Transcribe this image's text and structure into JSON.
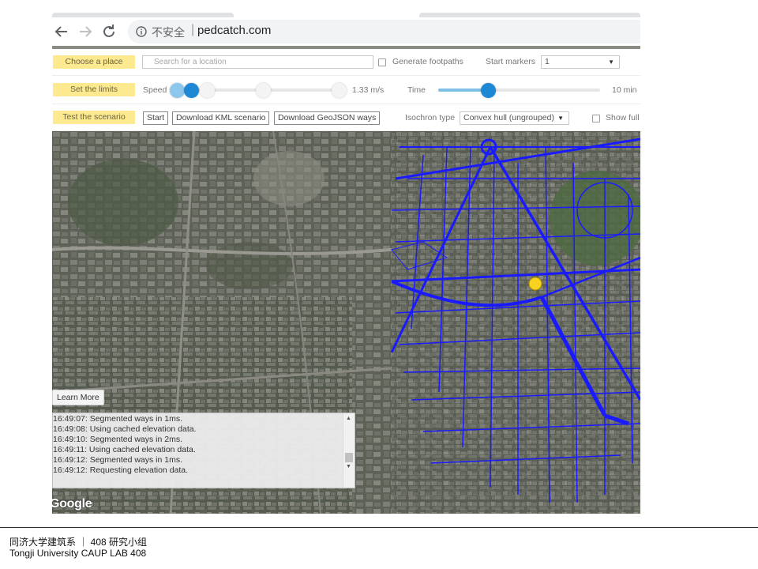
{
  "browser": {
    "insecure_label": "不安全",
    "separator": "|",
    "url": "pedcatch.com"
  },
  "toolbar": {
    "choose_place": "Choose a place",
    "search_placeholder": "Search for a location",
    "generate_footpaths": "Generate footpaths",
    "start_markers_label": "Start markers",
    "start_markers_value": "1",
    "set_limits": "Set the limits",
    "speed_label": "Speed",
    "speed_value": "1.33 m/s",
    "speed_fraction": 0.08,
    "time_label": "Time",
    "time_value": "10 min",
    "time_fraction": 0.31,
    "test_scenario": "Test the scenario",
    "start_button": "Start",
    "download_kml": "Download KML scenario",
    "download_geojson": "Download GeoJSON ways",
    "isochron_label": "Isochron type",
    "isochron_value": "Convex hull (ungrouped)",
    "show_full": "Show full"
  },
  "map": {
    "learn_more": "Learn More",
    "google_logo": "Google",
    "network_color": "#1a1aff",
    "marker_color": "#f7d21e",
    "console_lines": [
      "16:49:07: Segmented ways in 1ms.",
      "16:49:08: Using cached elevation data.",
      "16:49:10: Segmented ways in 2ms.",
      "16:49:11: Using cached elevation data.",
      "16:49:12: Segmented ways in 1ms.",
      "16:49:12: Requesting elevation data."
    ]
  },
  "footer": {
    "line1": "同济大学建筑系 ｜ 408 研究小组",
    "line2": "Tongji  University  CAUP   LAB  408"
  }
}
